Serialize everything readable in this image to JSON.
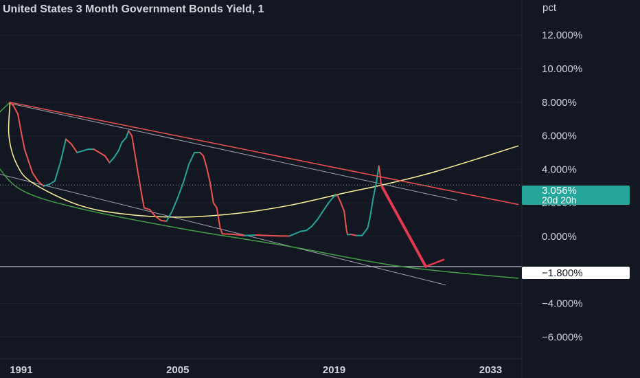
{
  "chart_data": {
    "type": "line",
    "title": "United States 3 Month Government Bonds Yield, 1",
    "unit_label": "pct",
    "last_value_label": "3.056%",
    "countdown_label": "20d 20h",
    "horizontal_line_label": "−1.800%",
    "horizontal_line_value": -1.8,
    "x_ticks": [
      "1991",
      "2005",
      "2019",
      "2033"
    ],
    "x_range": [
      1989.1,
      2035.8
    ],
    "y_ticks": [
      {
        "value": 12,
        "label": "12.000%"
      },
      {
        "value": 10,
        "label": "10.000%"
      },
      {
        "value": 8,
        "label": "8.000%"
      },
      {
        "value": 6,
        "label": "6.000%"
      },
      {
        "value": 4,
        "label": "4.000%"
      },
      {
        "value": 2,
        "label": "2.000%"
      },
      {
        "value": 0,
        "label": "0.000%"
      },
      {
        "value": -4,
        "label": "−4.000%"
      },
      {
        "value": -6,
        "label": "−6.000%"
      }
    ],
    "y_range": [
      -7.3,
      14.1
    ],
    "series": [
      {
        "color": "#26a69a",
        "down_color": "#ef5350",
        "x": [
          1990.0,
          1990.3,
          1990.7,
          1991.0,
          1991.3,
          1991.7,
          1992.0,
          1992.5,
          1993.0,
          1993.5,
          1994.0,
          1994.5,
          1995.0,
          1995.5,
          1996.0,
          1996.5,
          1997.0,
          1997.5,
          1998.0,
          1998.5,
          1998.9,
          1999.3,
          1999.7,
          2000.0,
          2000.4,
          2000.6,
          2000.9,
          2001.2,
          2001.5,
          2001.8,
          2002.0,
          2002.5,
          2003.0,
          2003.5,
          2004.0,
          2004.5,
          2005.0,
          2005.5,
          2006.0,
          2006.5,
          2007.0,
          2007.3,
          2007.6,
          2007.9,
          2008.2,
          2008.5,
          2008.8,
          2009.0,
          2010.0,
          2011.0,
          2012.0,
          2013.0,
          2014.0,
          2015.0,
          2016.0,
          2016.5,
          2017.0,
          2017.5,
          2018.0,
          2018.5,
          2019.0,
          2019.3,
          2019.6,
          2019.9,
          2020.1,
          2020.2,
          2020.5,
          2021.0,
          2021.5,
          2022.0,
          2022.2,
          2022.5,
          2022.8,
          2023.0,
          2023.1,
          2023.2
        ],
        "values": [
          8.0,
          7.8,
          7.3,
          6.2,
          5.2,
          4.4,
          3.8,
          3.3,
          3.0,
          3.1,
          3.3,
          4.4,
          5.8,
          5.5,
          5.0,
          5.1,
          5.2,
          5.2,
          5.0,
          4.8,
          4.4,
          4.7,
          5.1,
          5.6,
          5.9,
          6.3,
          6.0,
          4.8,
          3.6,
          2.4,
          1.7,
          1.6,
          1.2,
          0.95,
          0.9,
          1.5,
          2.3,
          3.2,
          4.3,
          5.0,
          5.0,
          4.8,
          4.1,
          3.2,
          2.0,
          1.7,
          0.5,
          0.15,
          0.12,
          0.05,
          0.08,
          0.05,
          0.03,
          0.02,
          0.3,
          0.35,
          0.6,
          1.0,
          1.5,
          2.0,
          2.4,
          2.45,
          2.0,
          1.5,
          0.4,
          0.1,
          0.12,
          0.05,
          0.05,
          0.5,
          1.1,
          2.3,
          3.3,
          4.2,
          3.8,
          3.06
        ]
      }
    ],
    "annotations": {
      "red_trendline": {
        "color": "#ef5350",
        "points": [
          [
            1990.0,
            8.0
          ],
          [
            2035.5,
            1.9
          ]
        ]
      },
      "white_line_upper": {
        "color": "#d1d4dc",
        "points": [
          [
            1990.2,
            7.9
          ],
          [
            2030.0,
            2.15
          ]
        ]
      },
      "white_line_lower": {
        "color": "#d1d4dc",
        "points": [
          [
            1988.5,
            3.8
          ],
          [
            2029.0,
            -2.9
          ]
        ]
      },
      "green_curve": {
        "color": "#43a047",
        "points": [
          [
            1990.0,
            8.0
          ],
          [
            1988.6,
            7.0
          ],
          [
            1988.0,
            5.6
          ],
          [
            1989.0,
            4.1
          ],
          [
            1991.2,
            2.7
          ],
          [
            1996.0,
            1.7
          ],
          [
            2005.0,
            0.5
          ],
          [
            2015.0,
            -0.6
          ],
          [
            2025.0,
            -1.8
          ],
          [
            2035.5,
            -2.5
          ]
        ]
      },
      "yellow_curve": {
        "color": "#fff59d",
        "points": [
          [
            1990.0,
            8.0
          ],
          [
            1989.9,
            6.0
          ],
          [
            1990.6,
            4.3
          ],
          [
            1992.0,
            3.2
          ],
          [
            1996.0,
            1.9
          ],
          [
            2000.0,
            1.35
          ],
          [
            2005.0,
            1.15
          ],
          [
            2010.0,
            1.35
          ],
          [
            2015.0,
            1.85
          ],
          [
            2020.0,
            2.6
          ],
          [
            2023.2,
            3.05
          ],
          [
            2028.0,
            3.85
          ],
          [
            2035.5,
            5.4
          ]
        ]
      },
      "forecast_arrow": {
        "color": "#e53950",
        "from": [
          2023.3,
          2.95
        ],
        "to": [
          2027.2,
          -1.8
        ]
      }
    }
  }
}
